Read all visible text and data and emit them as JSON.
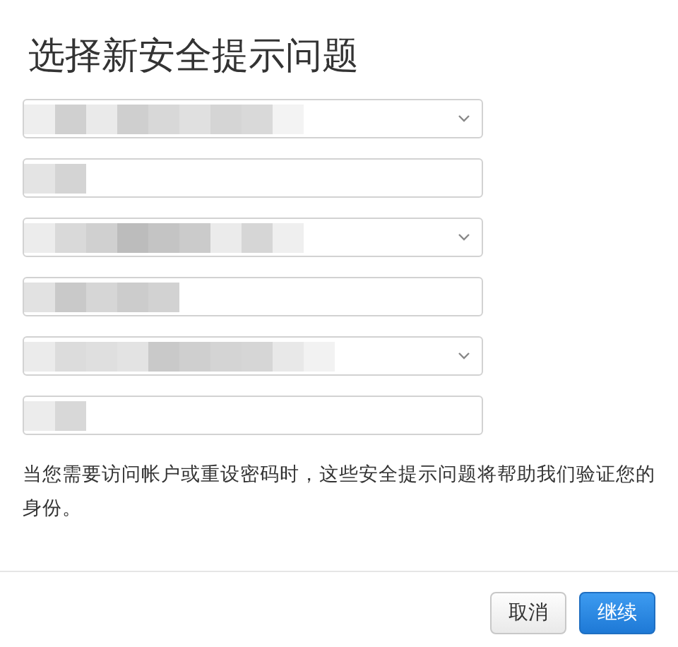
{
  "title": "选择新安全提示问题",
  "fields": [
    {
      "kind": "select"
    },
    {
      "kind": "text"
    },
    {
      "kind": "select"
    },
    {
      "kind": "text"
    },
    {
      "kind": "select"
    },
    {
      "kind": "text"
    }
  ],
  "description": "当您需要访问帐户或重设密码时，这些安全提示问题将帮助我们验证您的身份。",
  "buttons": [
    {
      "label": "取消",
      "kind": "secondary"
    },
    {
      "label": "继续",
      "kind": "primary"
    }
  ]
}
